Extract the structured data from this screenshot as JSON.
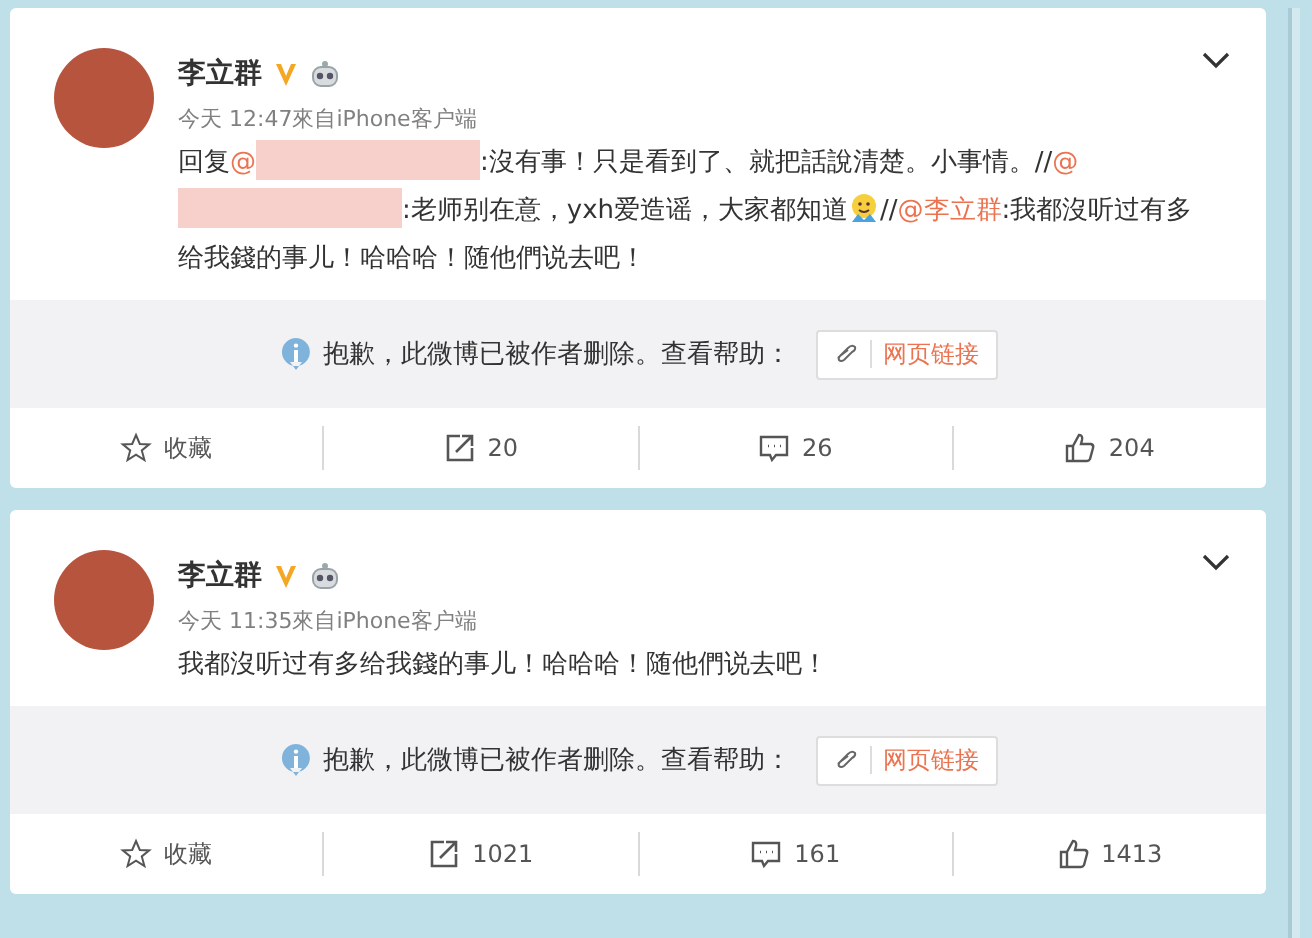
{
  "posts": [
    {
      "author": "李立群",
      "meta": "今天 12:47來自iPhone客户端",
      "body": [
        {
          "kind": "text",
          "text": "回复"
        },
        {
          "kind": "mention",
          "text": "@"
        },
        {
          "kind": "redacted"
        },
        {
          "kind": "text",
          "text": ":沒有事！只是看到了、就把話說清楚。小事情。//"
        },
        {
          "kind": "mention",
          "text": "@"
        },
        {
          "kind": "redacted"
        },
        {
          "kind": "text",
          "text": ":老师别在意，yxh爱造谣，大家都知道"
        },
        {
          "kind": "emoji"
        },
        {
          "kind": "text",
          "text": "//"
        },
        {
          "kind": "mention",
          "text": "@李立群"
        },
        {
          "kind": "text",
          "text": ":我都沒听过有多给我錢的事儿！哈哈哈！随他們说去吧！"
        }
      ],
      "notice": "抱歉，此微博已被作者删除。查看帮助：",
      "link": "网页链接",
      "actions": [
        {
          "kind": "favorite",
          "label": "收藏"
        },
        {
          "kind": "repost",
          "label": "20"
        },
        {
          "kind": "comment",
          "label": "26"
        },
        {
          "kind": "like",
          "label": "204"
        }
      ]
    },
    {
      "author": "李立群",
      "meta": "今天 11:35來自iPhone客户端",
      "body": [
        {
          "kind": "text",
          "text": "我都沒听过有多给我錢的事儿！哈哈哈！随他們说去吧！"
        }
      ],
      "notice": "抱歉，此微博已被作者删除。查看帮助：",
      "link": "网页链接",
      "actions": [
        {
          "kind": "favorite",
          "label": "收藏"
        },
        {
          "kind": "repost",
          "label": "1021"
        },
        {
          "kind": "comment",
          "label": "161"
        },
        {
          "kind": "like",
          "label": "1413"
        }
      ]
    }
  ]
}
